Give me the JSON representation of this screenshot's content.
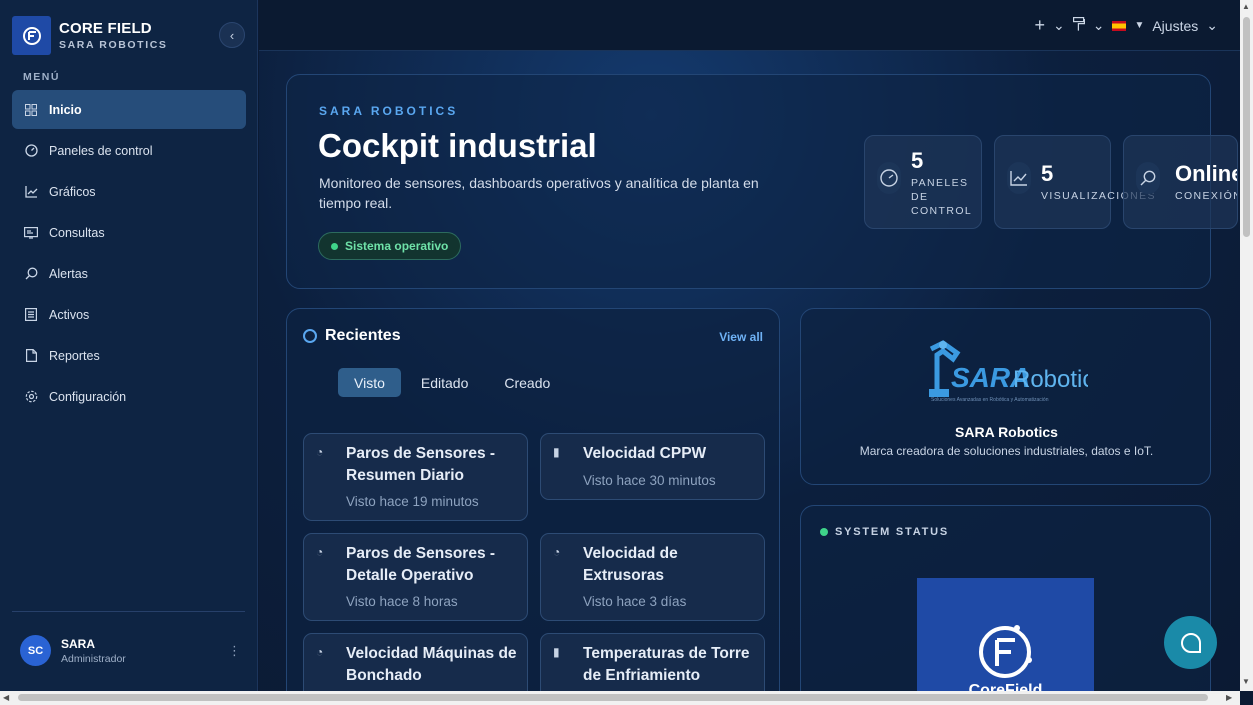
{
  "brand": {
    "title": "CORE FIELD",
    "subtitle": "SARA ROBOTICS"
  },
  "sidebar": {
    "menu_label": "MENÚ",
    "items": [
      {
        "label": "Inicio",
        "icon": "grid-icon",
        "active": true
      },
      {
        "label": "Paneles de control",
        "icon": "gauge-icon"
      },
      {
        "label": "Gráficos",
        "icon": "chart-line-icon"
      },
      {
        "label": "Consultas",
        "icon": "terminal-icon"
      },
      {
        "label": "Alertas",
        "icon": "search-alert-icon"
      },
      {
        "label": "Activos",
        "icon": "list-icon"
      },
      {
        "label": "Reportes",
        "icon": "file-icon"
      },
      {
        "label": "Configuración",
        "icon": "gear-icon"
      }
    ]
  },
  "user": {
    "initials": "SC",
    "name": "SARA",
    "role": "Administrador"
  },
  "topbar": {
    "settings_label": "Ajustes"
  },
  "hero": {
    "kicker": "SARA ROBOTICS",
    "title": "Cockpit industrial",
    "description": "Monitoreo de sensores, dashboards operativos y analítica de planta en tiempo real.",
    "status": "Sistema operativo",
    "stats": [
      {
        "value": "5",
        "label": "PANELES DE CONTROL",
        "icon": "gauge-icon"
      },
      {
        "value": "5",
        "label": "VISUALIZACIONES",
        "icon": "chart-line-icon"
      },
      {
        "value": "Online",
        "label": "CONEXIÓN",
        "icon": "search-icon"
      }
    ]
  },
  "recents": {
    "title": "Recientes",
    "view_all": "View all",
    "tabs": [
      "Visto",
      "Editado",
      "Creado"
    ],
    "items": [
      {
        "title": "Paros de Sensores - Resumen Diario",
        "meta": "Visto hace 19 minutos",
        "icon": "gauge-icon"
      },
      {
        "title": "Velocidad CPPW",
        "meta": "Visto hace 30 minutos",
        "icon": "bar-chart-icon"
      },
      {
        "title": "Paros de Sensores - Detalle Operativo",
        "meta": "Visto hace 8 horas",
        "icon": "gauge-icon"
      },
      {
        "title": "Velocidad de Extrusoras",
        "meta": "Visto hace 3 días",
        "icon": "gauge-icon"
      },
      {
        "title": "Velocidad Máquinas de Bonchado",
        "meta": "",
        "icon": "gauge-icon"
      },
      {
        "title": "Temperaturas de Torre de Enfriamiento",
        "meta": "",
        "icon": "bar-chart-icon"
      }
    ]
  },
  "brand_card": {
    "logo_text": "SARARobotics",
    "name": "SARA Robotics",
    "description": "Marca creadora de soluciones industriales, datos e IoT."
  },
  "system_status": {
    "title": "SYSTEM STATUS",
    "logo_text": "CoreField"
  }
}
